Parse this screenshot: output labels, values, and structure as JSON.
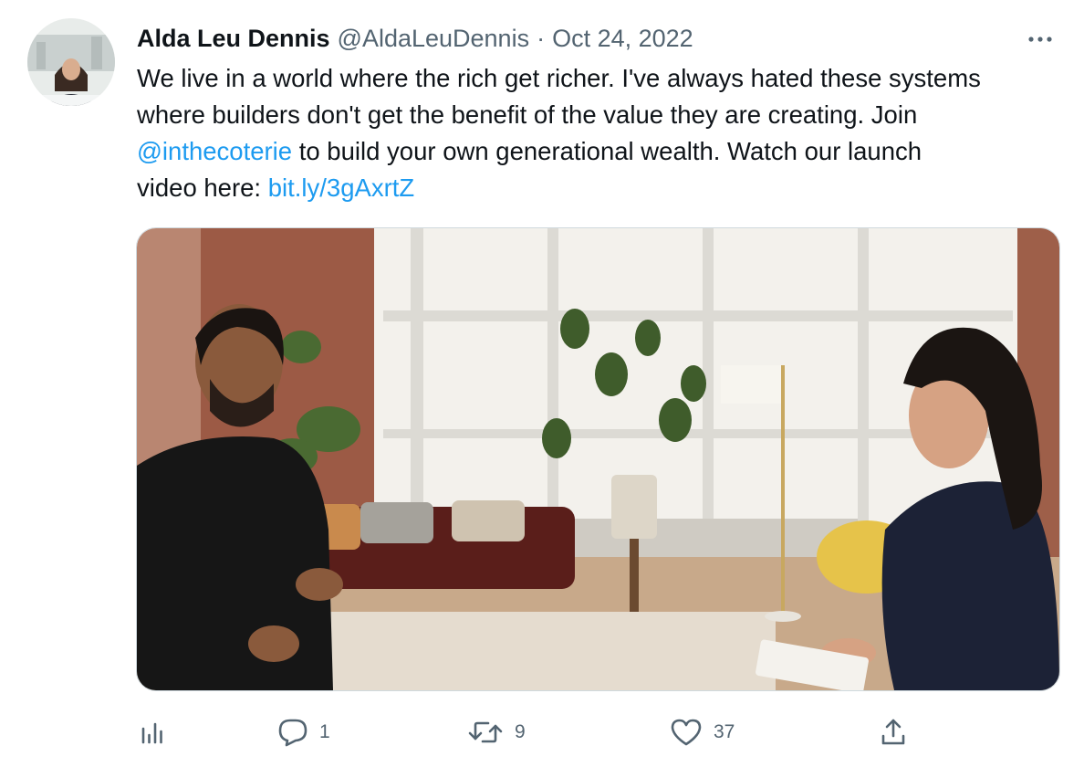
{
  "tweet": {
    "author": {
      "display_name": "Alda Leu Dennis",
      "handle": "@AldaLeuDennis"
    },
    "separator": "·",
    "date": "Oct 24, 2022",
    "text": {
      "line1": "We live in a world where the rich get richer. I've always hated these systems",
      "line2": "where builders don't get the benefit of the value they are creating. Join",
      "mention": "@inthecoterie",
      "line3_rest": " to build your own generational wealth. Watch our launch",
      "line4_prefix": "video here: ",
      "link": "bit.ly/3gAxrtZ"
    },
    "media": {
      "type": "video-thumbnail"
    },
    "actions": {
      "reply_count": "1",
      "retweet_count": "9",
      "like_count": "37"
    },
    "icons": {
      "more": "more-dots-icon",
      "analytics": "analytics-icon",
      "reply": "reply-icon",
      "retweet": "retweet-icon",
      "like": "heart-icon",
      "share": "share-icon"
    },
    "colors": {
      "link": "#1d9bf0",
      "secondary_text": "#536471",
      "primary_text": "#0f1419"
    }
  }
}
